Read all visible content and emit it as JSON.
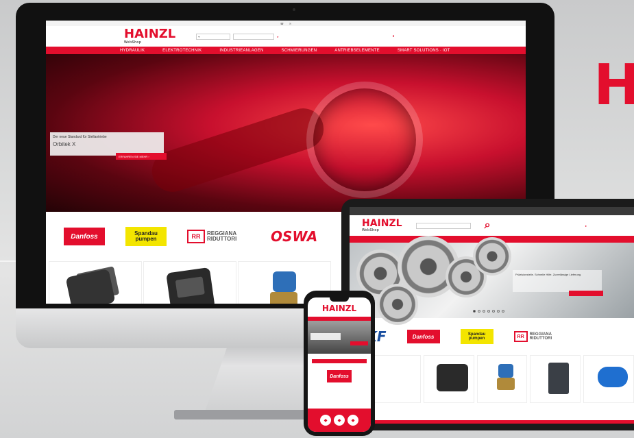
{
  "brand": {
    "wordmark": "H",
    "logo": "HAINZL",
    "logo_sub": "WebShop",
    "accent_color": "#e30e2d"
  },
  "desktop": {
    "nav": [
      "HYDRAULIK",
      "ELEKTROTECHNIK",
      "INDUSTRIEANLAGEN",
      "SCHMIERUNGEN",
      "ANTRIEBSELEMENTE",
      "SMART SOLUTIONS · IOT"
    ],
    "hero": {
      "caption_line1": "Der neue Standard für Stellantriebe",
      "caption_line2": "Orbitek X",
      "cta": "ERFAHREN SIE MEHR ›"
    },
    "brands": {
      "danfoss": "Danfoss",
      "spandau_1": "Spandau",
      "spandau_2": "pumpen",
      "reggiana_mark": "RR",
      "reggiana_1": "REGGIANA",
      "reggiana_2": "RIDUTTORI",
      "oswa": "OSWA"
    }
  },
  "tablet": {
    "hero_caption": "Präzisionsteile. Schnelle Hilfe. Zuverlässige Lieferung.",
    "brands": {
      "skf": "SKF",
      "danfoss": "Danfoss",
      "spandau_1": "Spandau",
      "spandau_2": "pumpen",
      "reggiana_mark": "RR",
      "reggiana_1": "REGGIANA",
      "reggiana_2": "RIDUTTORI"
    }
  },
  "phone": {
    "logo": "HAINZL",
    "danfoss": "Danfoss"
  },
  "icons": [
    "search-icon",
    "cart-icon",
    "slider-dots"
  ]
}
